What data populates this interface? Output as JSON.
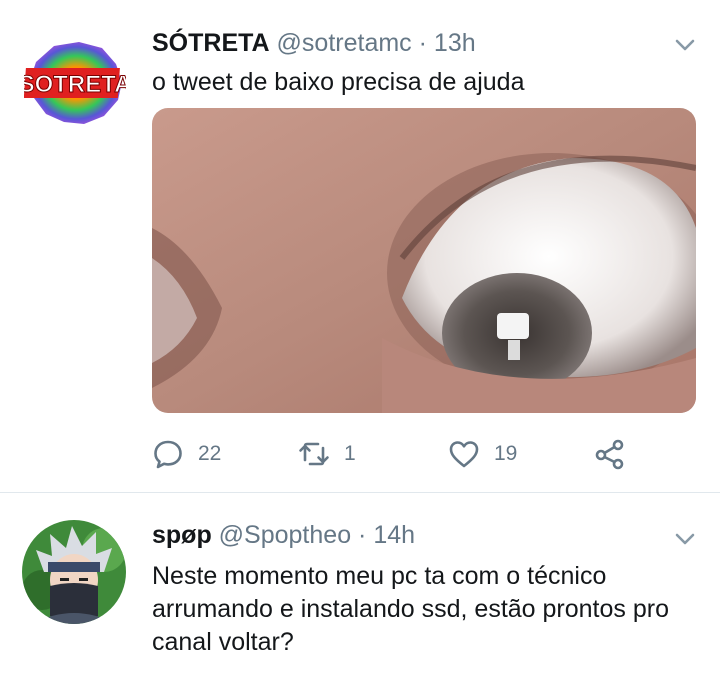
{
  "colors": {
    "secondary_text": "#657786",
    "primary_text": "#14171a",
    "divider": "#e1e8ed"
  },
  "tweets": [
    {
      "avatar_icon": "sotreta-logo-icon",
      "logo_text": "SOTRETA",
      "name": "SÓTRETA",
      "handle": "@sotretamc",
      "separator": "·",
      "time": "13h",
      "text": "o tweet de baixo precisa de ajuda",
      "media_icon": "eye-photo",
      "replies": "22",
      "retweets": "1",
      "likes": "19"
    },
    {
      "avatar_icon": "masked-ninja-avatar",
      "name": "spøp",
      "handle": "@Spoptheo",
      "separator": "·",
      "time": "14h",
      "text": "Neste momento meu pc ta com o técnico arrumando e instalando ssd, estão prontos pro canal voltar?"
    }
  ]
}
